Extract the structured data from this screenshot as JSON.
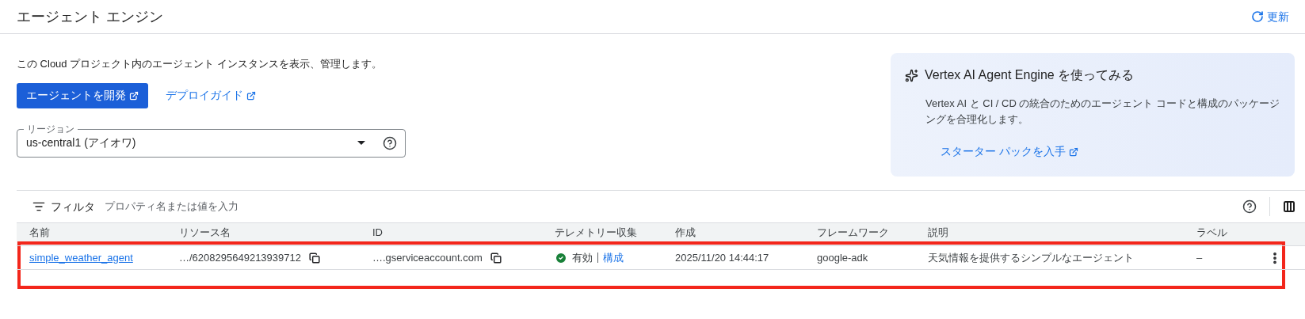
{
  "header": {
    "title": "エージェント エンジン",
    "refresh": "更新"
  },
  "intro": {
    "description": "この Cloud プロジェクト内のエージェント インスタンスを表示、管理します。",
    "develop_button": "エージェントを開発",
    "deploy_link": "デプロイガイド"
  },
  "region": {
    "label": "リージョン",
    "value": "us-central1 (アイオワ)"
  },
  "promo": {
    "title": "Vertex AI Agent Engine を使ってみる",
    "body": "Vertex AI と CI / CD の統合のためのエージェント コードと構成のパッケージングを合理化します。",
    "link": "スターター パックを入手"
  },
  "filter": {
    "label": "フィルタ",
    "placeholder": "プロパティ名または値を入力"
  },
  "table": {
    "columns": [
      "名前",
      "リソース名",
      "ID",
      "テレメトリー収集",
      "作成",
      "フレームワーク",
      "説明",
      "ラベル"
    ],
    "rows": [
      {
        "name": "simple_weather_agent",
        "resource": "…/6208295649213939712",
        "id": "….gserviceaccount.com",
        "telemetry_enabled": true,
        "telemetry": "有効",
        "config": "構成",
        "created": "2025/11/20 14:44:17",
        "framework": "google-adk",
        "description": "天気情報を提供するシンプルなエージェント",
        "labels": "–",
        "highlighted": true
      }
    ]
  }
}
